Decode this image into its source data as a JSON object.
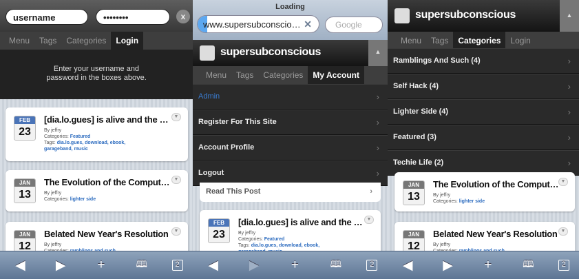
{
  "panel1": {
    "username": "username",
    "password": "••••••••",
    "clear_icon": "x",
    "tabs": [
      "Menu",
      "Tags",
      "Categories",
      "Login"
    ],
    "message": "Enter your username and password in the boxes above.",
    "posts": [
      {
        "month": "FEB",
        "day": "23",
        "title": "[dia.lo.gues] is alive and the …",
        "by": "By jeffry",
        "categories_label": "Categories:",
        "categories": "Featured",
        "tags_label": "Tags:",
        "tags": "dia.lo.gues, download, ebook,",
        "tags2": "garageband, music"
      },
      {
        "month": "JAN",
        "day": "13",
        "title": "The Evolution of the Comput…",
        "by": "By jeffry",
        "categories_label": "Categories:",
        "categories": "lighter side"
      },
      {
        "month": "JAN",
        "day": "12",
        "title": "Belated New Year's Resolution",
        "by": "By jeffry",
        "categories_label": "Categories:",
        "categories": "ramblings and such"
      }
    ]
  },
  "panel2": {
    "loading": "Loading",
    "url": "www.supersubconscio…",
    "search_placeholder": "Google",
    "site": "supersubconscious",
    "tabs": [
      "Menu",
      "Tags",
      "Categories",
      "My Account"
    ],
    "account": [
      "Admin",
      "Register For This Site",
      "Account Profile",
      "Logout"
    ],
    "read_post": "Read This Post",
    "post": {
      "month": "FEB",
      "day": "23",
      "title": "[dia.lo.gues] is alive and the …",
      "by": "By jeffry",
      "categories_label": "Categories:",
      "categories": "Featured",
      "tags_label": "Tags:",
      "tags": "dia.lo.gues, download, ebook,",
      "tags2": "garageband, music"
    }
  },
  "panel3": {
    "site": "supersubconscious",
    "tabs": [
      "Menu",
      "Tags",
      "Categories",
      "Login"
    ],
    "categories": [
      "Ramblings And Such (4)",
      "Self Hack (4)",
      "Lighter Side (4)",
      "Featured (3)",
      "Techie Life (2)"
    ],
    "posts": [
      {
        "month": "JAN",
        "day": "13",
        "title": "The Evolution of the Comput…",
        "by": "By jeffry",
        "categories_label": "Categories:",
        "categories": "lighter side"
      },
      {
        "month": "JAN",
        "day": "12",
        "title": "Belated New Year's Resolution",
        "by": "By jeffry",
        "categories_label": "Categories:",
        "categories": "ramblings and such"
      }
    ]
  },
  "toolbar": {
    "icons": [
      "back-icon",
      "forward-icon",
      "add-icon",
      "bookmarks-icon",
      "pages-icon"
    ],
    "glyphs": [
      "◀",
      "▶",
      "+",
      "📖",
      "❐"
    ],
    "pages_count": "2"
  },
  "colors": {
    "accent": "#2b6bbf",
    "toolbar": "#7a8fa9",
    "dark": "#222222"
  }
}
